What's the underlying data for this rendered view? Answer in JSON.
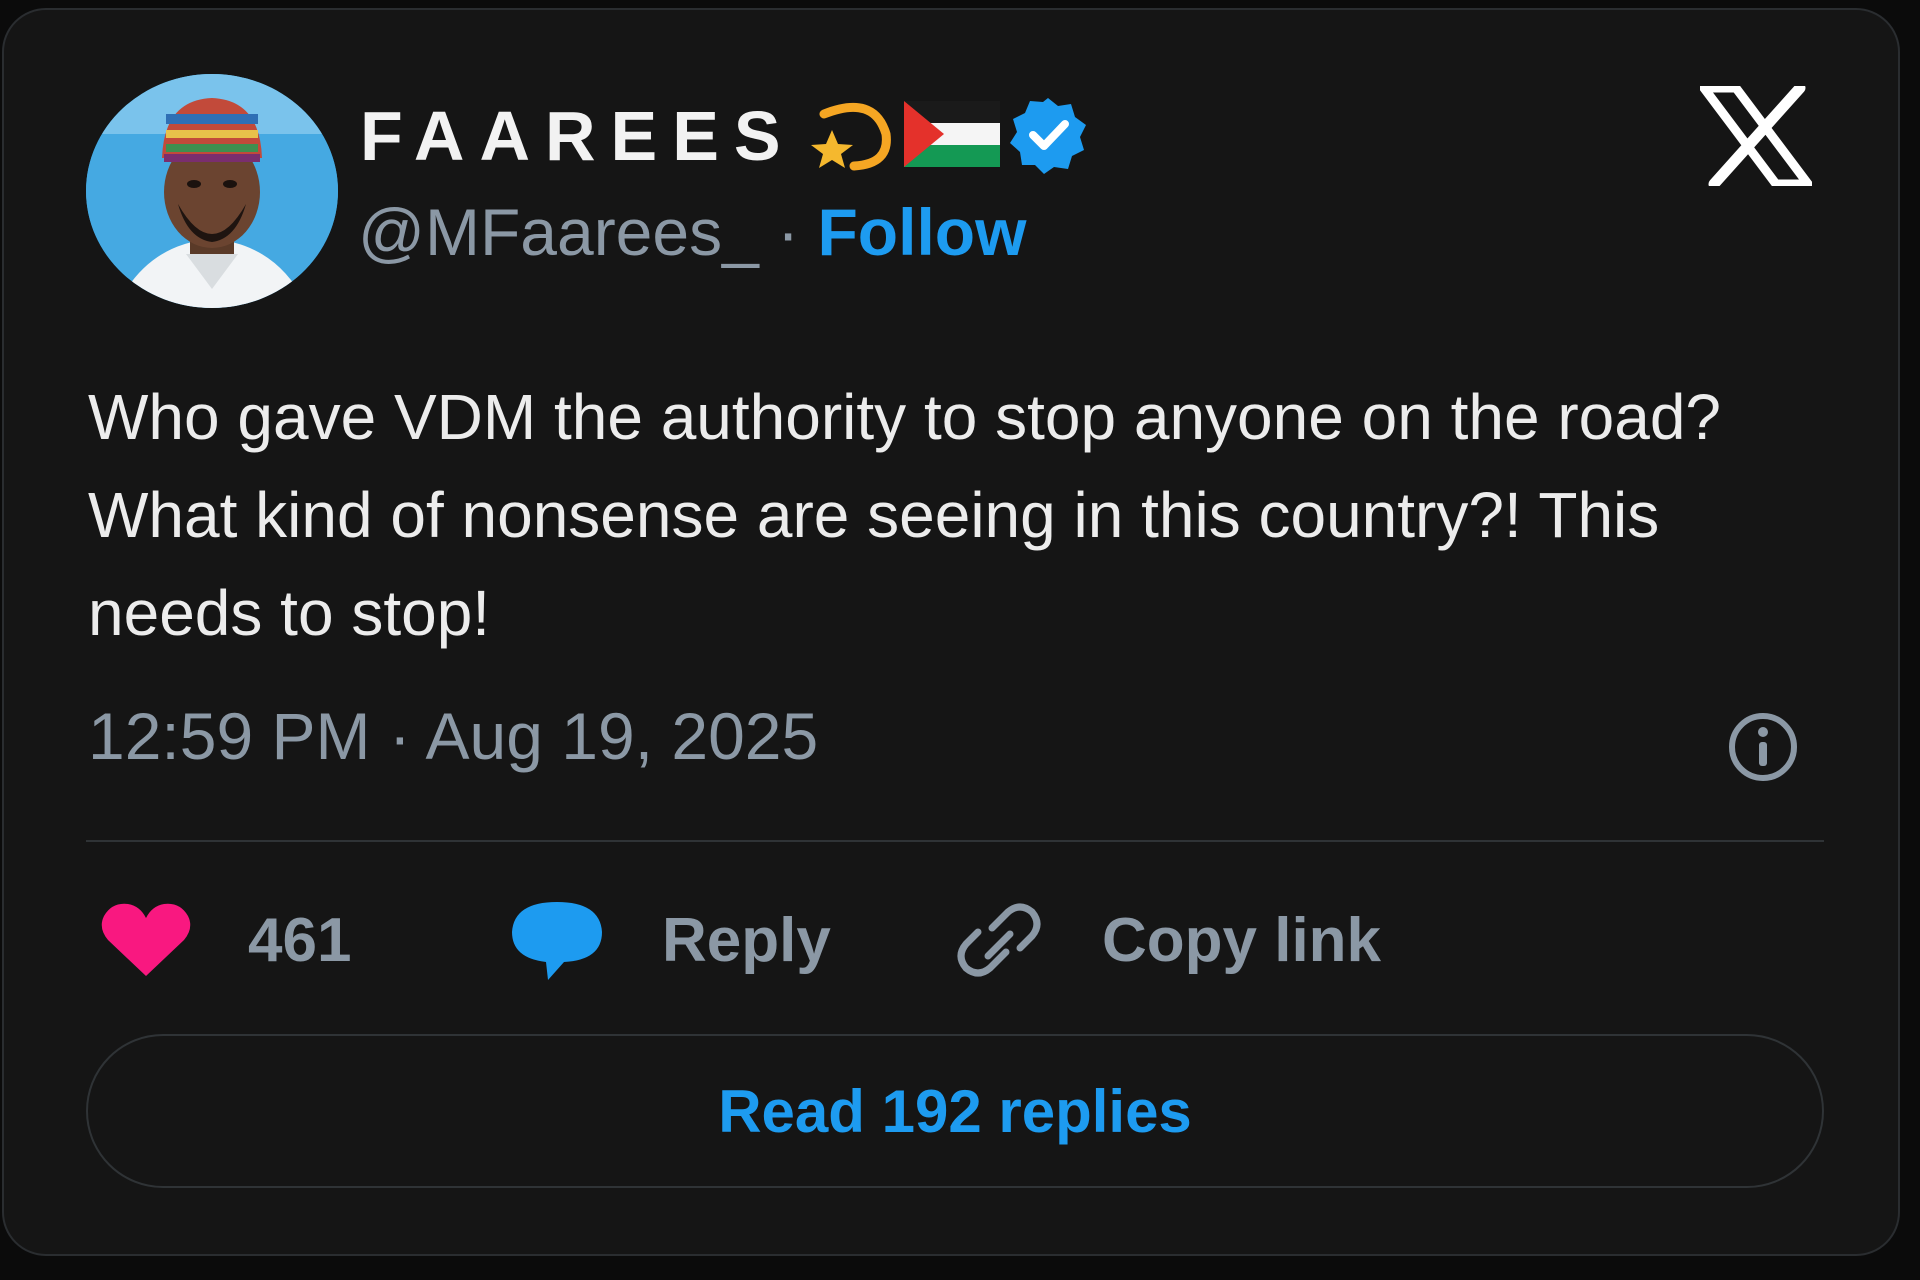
{
  "author": {
    "display_name": "FAAREES",
    "handle": "@MFaarees_",
    "separator": "·",
    "follow_label": "Follow",
    "verified": true,
    "avatar_icon": "profile-photo",
    "name_emojis": [
      "shooting-star-icon",
      "palestine-flag-icon"
    ]
  },
  "tweet": {
    "text": "Who gave VDM the authority to stop anyone on the road? What kind of nonsense are seeing in this country?! This needs to stop!",
    "timestamp": "12:59 PM · Aug 19, 2025"
  },
  "actions": {
    "like_count": "461",
    "reply_label": "Reply",
    "copy_link_label": "Copy link"
  },
  "read_replies_label": "Read 192 replies",
  "colors": {
    "background": "#151515",
    "accent": "#1d9bf0",
    "like": "#f91880",
    "muted_text": "#8b98a5"
  }
}
